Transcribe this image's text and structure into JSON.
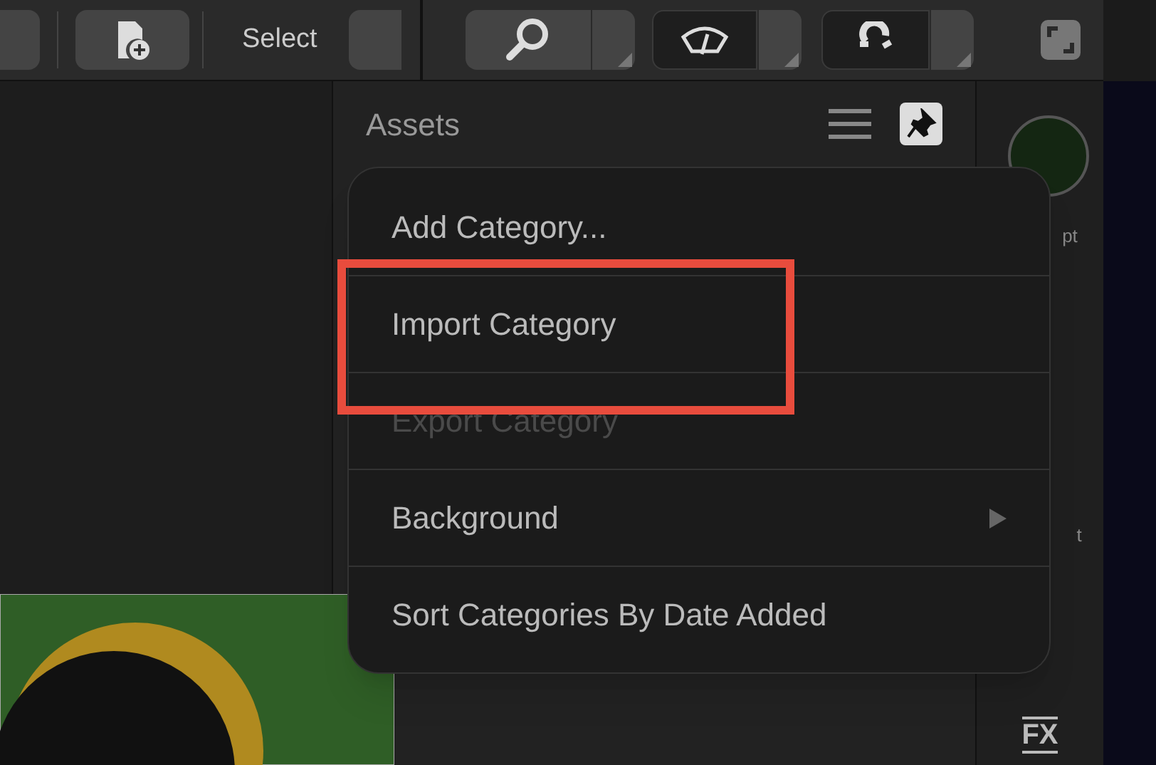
{
  "toolbar": {
    "select_label": "Select"
  },
  "assets_panel": {
    "title": "Assets",
    "pinned": true
  },
  "context_menu": {
    "items": [
      {
        "label": "Add Category...",
        "disabled": false,
        "submenu": false,
        "highlighted": false
      },
      {
        "label": "Import Category",
        "disabled": false,
        "submenu": false,
        "highlighted": true
      },
      {
        "label": "Export Category",
        "disabled": true,
        "submenu": false,
        "highlighted": false
      },
      {
        "label": "Background",
        "disabled": false,
        "submenu": true,
        "highlighted": false
      },
      {
        "label": "Sort Categories By Date Added",
        "disabled": false,
        "submenu": false,
        "highlighted": false
      }
    ]
  },
  "right_strip": {
    "labels": [
      "pt",
      "t"
    ],
    "fx_label": "FX"
  }
}
